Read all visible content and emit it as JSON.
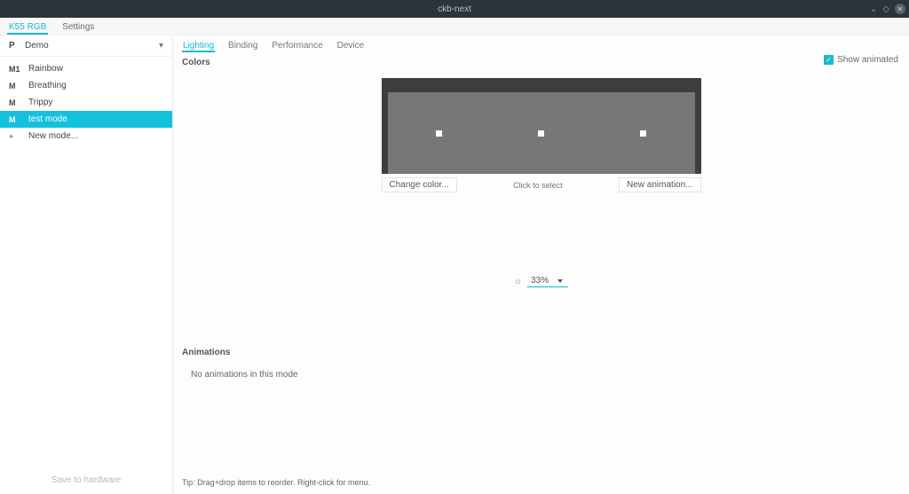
{
  "window": {
    "title": "ckb-next"
  },
  "toptabs": {
    "items": [
      "K55 RGB",
      "Settings"
    ],
    "active_index": 0
  },
  "profile": {
    "letter": "P",
    "name": "Demo",
    "chevron": "▾"
  },
  "modes": {
    "items": [
      {
        "tag": "M1",
        "name": "Rainbow",
        "selected": false
      },
      {
        "tag": "M",
        "name": "Breathing",
        "selected": false
      },
      {
        "tag": "M",
        "name": "Trippy",
        "selected": false
      },
      {
        "tag": "M",
        "name": "test mode",
        "selected": true
      }
    ],
    "add_label": "New mode..."
  },
  "save_hw_label": "Save to hardware",
  "subtabs": {
    "items": [
      "Lighting",
      "Binding",
      "Performance",
      "Device"
    ],
    "active_index": 0
  },
  "colors": {
    "label": "Colors",
    "show_animated_label": "Show animated",
    "show_animated_checked": true,
    "change_color_btn": "Change color...",
    "click_to_select": "Click to select",
    "new_anim_btn": "New animation...",
    "brightness": {
      "icon": "☼",
      "value": "33%",
      "caret": "▾"
    }
  },
  "animations": {
    "label": "Animations",
    "empty_text": "No animations in this mode"
  },
  "tip": "Tip: Drag+drop items to reorder. Right-click for menu."
}
